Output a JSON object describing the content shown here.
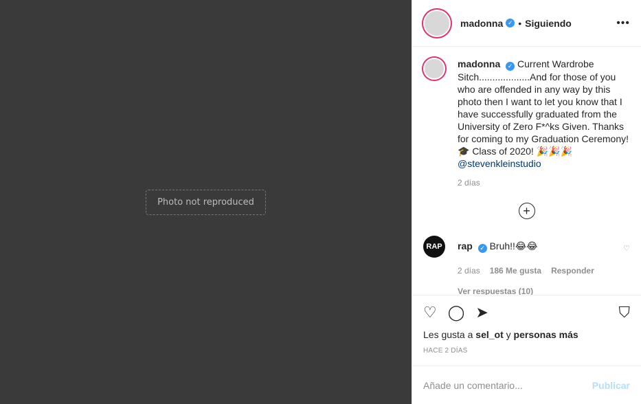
{
  "media": {
    "placeholder": "Photo not reproduced"
  },
  "header": {
    "username": "madonna",
    "verified": "✓",
    "separator": "•",
    "follow": "Siguiendo",
    "more": "•••"
  },
  "caption": {
    "username": "madonna",
    "text": "Current Wardrobe Sitch...................And for those of you who are offended in any way by this photo then I want to let you know that I have successfully graduated from the University of Zero F*^ks Given. Thanks for coming to my Graduation Ceremony! 🎓 Class of 2020! 🎉🎉🎉",
    "mention": "@stevenkleinstudio",
    "time": "2 días"
  },
  "load_more": "+",
  "comment": {
    "avatar_text": "RAP",
    "username": "rap",
    "text": "Bruh!!😂😂",
    "time": "2 días",
    "likes": "186 Me gusta",
    "reply": "Responder",
    "replies": "Ver respuestas (10)"
  },
  "actions": {
    "like_icon": "heart-icon",
    "comment_icon": "comment-icon",
    "share_icon": "share-icon",
    "save_icon": "bookmark-icon"
  },
  "likes": {
    "prefix": "Les gusta a",
    "user": "sel_ot",
    "joiner": "y",
    "others": "personas más"
  },
  "date": "HACE 2 DÍAS",
  "add_comment": {
    "placeholder": "Añade un comentario...",
    "publish": "Publicar"
  }
}
